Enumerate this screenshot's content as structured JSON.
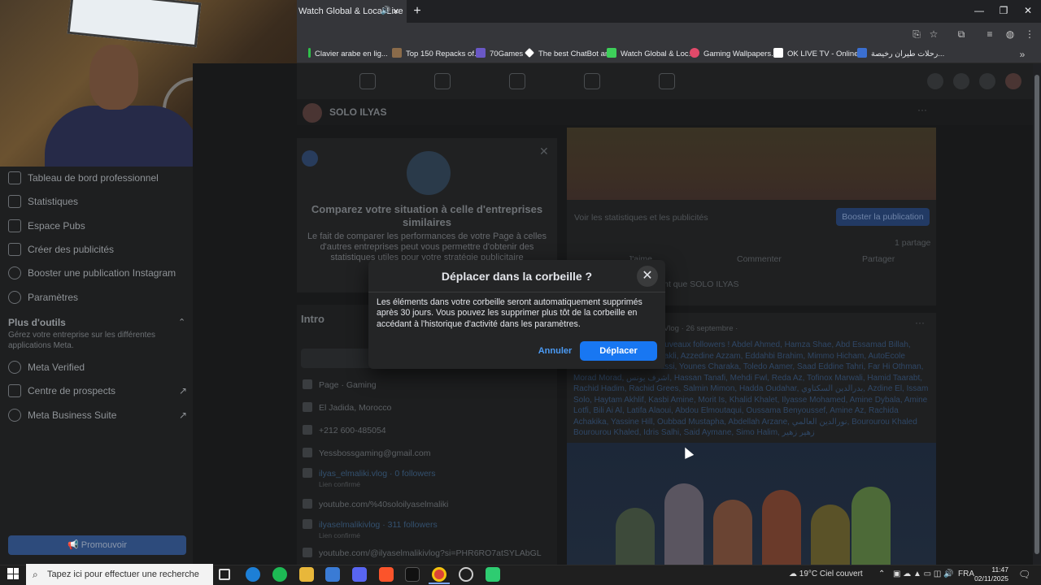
{
  "browser": {
    "tab_title": "Watch Global & Local Live",
    "tab_sound_icon": "speaker-icon",
    "bookmarks": [
      {
        "label": "Clavier arabe en lig..."
      },
      {
        "label": "Top 150 Repacks of..."
      },
      {
        "label": "70Games"
      },
      {
        "label": "The best ChatBot an..."
      },
      {
        "label": "Watch Global & Loc..."
      },
      {
        "label": "Gaming Wallpapers..."
      },
      {
        "label": "OK LIVE TV - Online..."
      },
      {
        "label": "رحلات طيران رخيصة..."
      }
    ]
  },
  "sidebar": {
    "items": [
      {
        "label": "Tableau de bord professionnel"
      },
      {
        "label": "Statistiques"
      },
      {
        "label": "Espace Pubs"
      },
      {
        "label": "Créer des publicités"
      },
      {
        "label": "Booster une publication Instagram"
      },
      {
        "label": "Paramètres"
      }
    ],
    "tools_heading": "Plus d'outils",
    "tools_desc": "Gérez votre entreprise sur les différentes applications Meta.",
    "tools": [
      {
        "label": "Meta Verified"
      },
      {
        "label": "Centre de prospects"
      },
      {
        "label": "Meta Business Suite"
      }
    ],
    "promote_label": "Promouvoir"
  },
  "page": {
    "name": "SOLO ILYAS",
    "compare_title": "Comparez votre situation à celle d'entreprises similaires",
    "compare_text": "Le fait de comparer les performances de votre Page à celles d'autres entreprises peut vous permettre d'obtenir des statistiques utiles pour votre stratégie publicitaire",
    "intro_title": "Intro",
    "info": [
      {
        "text": "Page · Gaming",
        "link": false
      },
      {
        "text": "El Jadida, Morocco",
        "link": false
      },
      {
        "text": "+212 600-485054",
        "link": false
      },
      {
        "text": "Yessbossgaming@gmail.com",
        "link": false
      },
      {
        "text": "ilyas_elmaliki.vlog · 0 followers",
        "link": true,
        "sub": "Lien confirmé"
      },
      {
        "text": "youtube.com/%40soloilyaselmaliki",
        "link": false
      },
      {
        "text": "ilyaselmalikivlog · 311 followers",
        "link": true,
        "sub": "Lien confirmé"
      },
      {
        "text": "youtube.com/@ilyaselmalikivlog?si=PHR6RO7atSYLAbGL",
        "link": false
      }
    ]
  },
  "post": {
    "stats_link": "Voir les statistiques et les publicités",
    "boost_label": "Booster la publication",
    "shares": "1 partage",
    "like": "J'aime",
    "comment": "Commenter",
    "share": "Partager",
    "comment_as": "Commenter en tant que SOLO ILYAS",
    "author_meta": "ilyas elmaliki Vlog · 26 septembre ·",
    "followers_text": "Un grand merci à mes nouveaux followers ! Abdel Ahmed, Hamza Shae, Abd Essamad Billah, Abderrahim Zakir, Jalal Bakli, Azzedine Azzam, Eddahbi Brahim, Mimmo Hicham, AutoEcole Oudades, Abderrahim Sassi, Younes Charaka, Toledo Aamer, Saad Eddine Tahri, Far Hi Othman, Morad Morad, اشرف يونس, Hassan Tanafi, Mehdi Fwl, Reda Az, Tofinox Marwali, Hamid Taarabt, Rachid Hadim, Rachid Grees, Salmin Mimon, Hadda Oudahar, بدرالدين السكتاوي, Azdine El, Issam Solo, Haytam Akhlif, Kasbi Amine, Morit Is, Khalid Khalet, Ilyasse Mohamed, Amine Dybala, Amine Lotfi, Bili Ai Al, Latifa Alaoui, Abdou Elmoutaqui, Oussama Benyoussef, Amine Az, Rachida Achakika, Yassine Hill, Oubbad Mustapha, Abdellah Arzane, نورالدين العالمي, Bourourou Khaled Bourourou Khaled, Idris Salhi, Said Aymane, Simo Halim, زهير زهير"
  },
  "modal": {
    "title": "Déplacer dans la corbeille ?",
    "body": "Les éléments dans votre corbeille seront automatiquement supprimés après 30 jours. Vous pouvez les supprimer plus tôt de la corbeille en accédant à l'historique d'activité dans les paramètres.",
    "cancel_label": "Annuler",
    "confirm_label": "Déplacer"
  },
  "taskbar": {
    "search_placeholder": "Tapez ici pour effectuer une recherche",
    "weather": "19°C  Ciel couvert",
    "lang": "FRA",
    "time": "11:47",
    "date": "02/11/2025"
  },
  "colors": {
    "accent": "#1877f2",
    "modal_bg": "#242526"
  }
}
